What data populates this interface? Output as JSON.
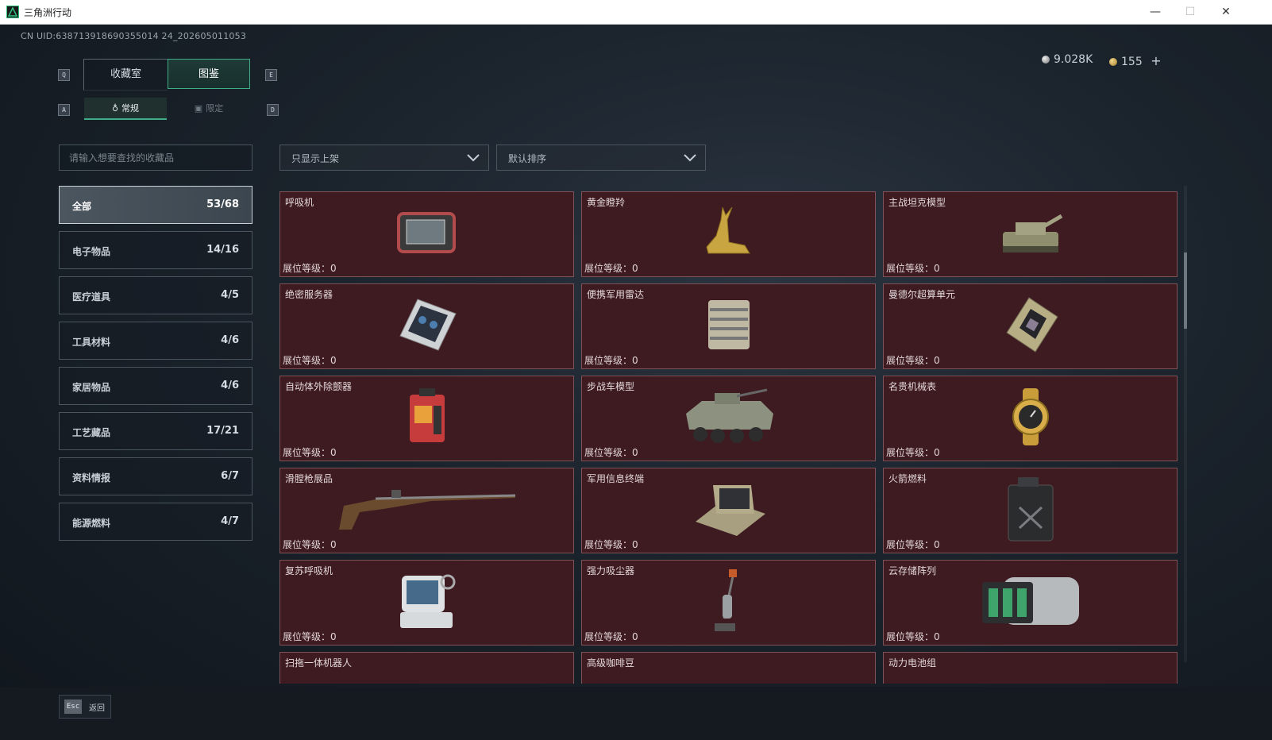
{
  "window": {
    "title": "三角洲行动",
    "minimize": "—",
    "maximize": "☐",
    "close": "✕"
  },
  "uid": "CN UID:638713918690355014 24_202605011053",
  "currency": {
    "silver": "9.028K",
    "gold": "155",
    "add": "+"
  },
  "tabs": {
    "key_left": "Q",
    "key_right": "E",
    "items": [
      {
        "label": "收藏室"
      },
      {
        "label": "图鉴"
      }
    ]
  },
  "subtabs": {
    "key_left": "A",
    "key_right": "D",
    "items": [
      {
        "label": "常规"
      },
      {
        "label": "限定"
      }
    ]
  },
  "search": {
    "placeholder": "请输入想要查找的收藏品"
  },
  "filters": {
    "shelf": "只显示上架",
    "sort": "默认排序"
  },
  "categories": [
    {
      "name": "全部",
      "count": "53/68"
    },
    {
      "name": "电子物品",
      "count": "14/16"
    },
    {
      "name": "医疗道具",
      "count": "4/5"
    },
    {
      "name": "工具材料",
      "count": "4/6"
    },
    {
      "name": "家居物品",
      "count": "4/6"
    },
    {
      "name": "工艺藏品",
      "count": "17/21"
    },
    {
      "name": "资料情报",
      "count": "6/7"
    },
    {
      "name": "能源燃料",
      "count": "4/7"
    }
  ],
  "level_label": "展位等级：0",
  "items": [
    {
      "name": "呼吸机",
      "icon": "ventilator-icon"
    },
    {
      "name": "黄金瞪羚",
      "icon": "golden-gazelle-icon"
    },
    {
      "name": "主战坦克模型",
      "icon": "tank-model-icon"
    },
    {
      "name": "绝密服务器",
      "icon": "server-icon"
    },
    {
      "name": "便携军用雷达",
      "icon": "radar-icon"
    },
    {
      "name": "曼德尔超算单元",
      "icon": "supercomputer-unit-icon"
    },
    {
      "name": "自动体外除颤器",
      "icon": "defibrillator-icon"
    },
    {
      "name": "步战车模型",
      "icon": "ifv-model-icon"
    },
    {
      "name": "名贵机械表",
      "icon": "watch-icon"
    },
    {
      "name": "滑膛枪展品",
      "icon": "musket-icon"
    },
    {
      "name": "军用信息终端",
      "icon": "terminal-icon"
    },
    {
      "name": "火箭燃料",
      "icon": "fuel-can-icon"
    },
    {
      "name": "复苏呼吸机",
      "icon": "resuscitator-icon"
    },
    {
      "name": "强力吸尘器",
      "icon": "vacuum-icon"
    },
    {
      "name": "云存储阵列",
      "icon": "storage-array-icon"
    },
    {
      "name": "扫拖一体机器人",
      "icon": "robot-vacuum-icon"
    },
    {
      "name": "高级咖啡豆",
      "icon": "coffee-icon"
    },
    {
      "name": "动力电池组",
      "icon": "battery-pack-icon"
    }
  ],
  "footer": {
    "esc_key": "Esc",
    "back_label": "返回"
  },
  "colors": {
    "card_bg": "#3e1a21",
    "card_border": "#7d5358",
    "accent": "#3fae86",
    "active_category": "#4c565f"
  }
}
